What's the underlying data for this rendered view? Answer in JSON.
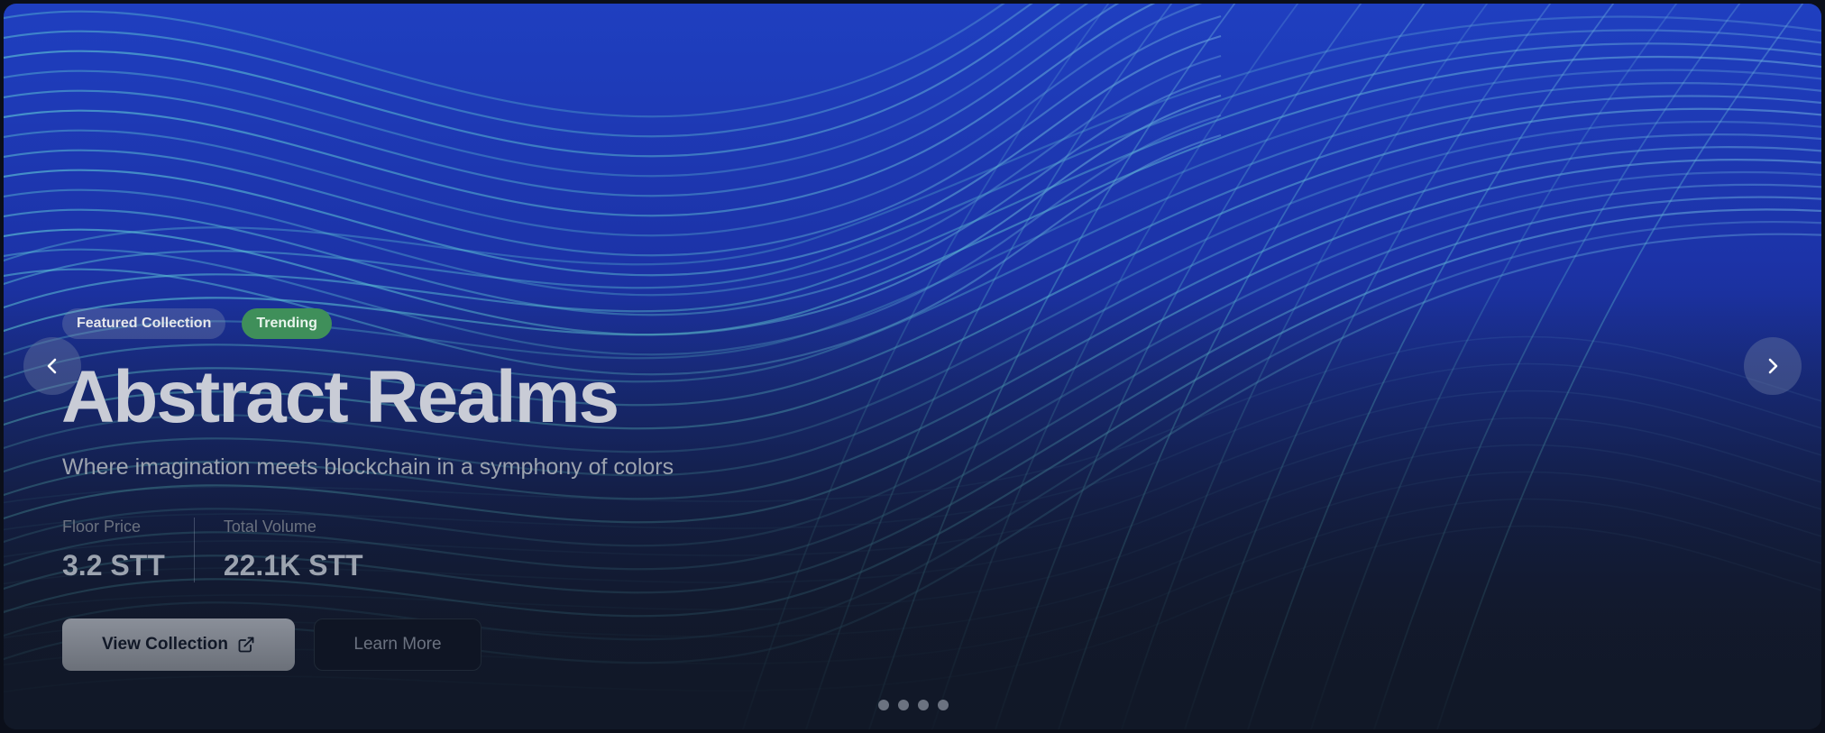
{
  "hero": {
    "badges": {
      "featured": "Featured Collection",
      "trending": "Trending"
    },
    "title": "Abstract Realms",
    "subtitle": "Where imagination meets blockchain in a symphony of colors",
    "stats": [
      {
        "label": "Floor Price",
        "value": "3.2 STT"
      },
      {
        "label": "Total Volume",
        "value": "22.1K STT"
      }
    ],
    "buttons": {
      "view_collection": "View Collection",
      "learn_more": "Learn More"
    },
    "carousel": {
      "slide_count": 4
    },
    "colors": {
      "trending_badge": "#3f8f5a",
      "background_top": "#1f3fc0",
      "background_bottom": "#111827"
    },
    "icons": {
      "prev": "chevron-left-icon",
      "next": "chevron-right-icon",
      "external": "external-link-icon"
    }
  }
}
